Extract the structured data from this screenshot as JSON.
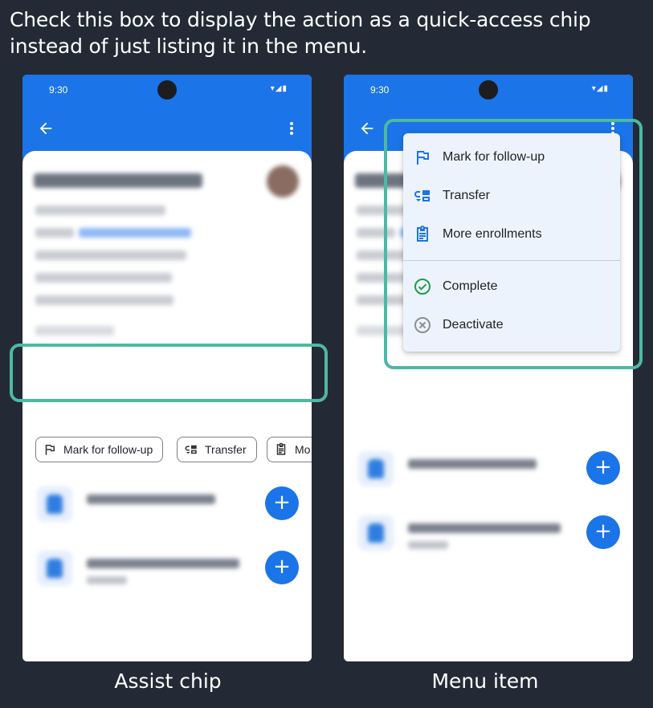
{
  "intro_text": "Check this box to display the action as a quick-access chip instead of just listing it in the menu.",
  "colors": {
    "background": "#232a36",
    "appbar": "#1b74e8",
    "highlight": "#4db8a4",
    "menu_bg": "#edf3fc"
  },
  "left_phone": {
    "status_time": "9:30",
    "chips": [
      {
        "icon": "flag-icon",
        "label": "Mark for follow-up"
      },
      {
        "icon": "transfer-icon",
        "label": "Transfer"
      },
      {
        "icon": "clipboard-icon",
        "label": "Mo"
      }
    ],
    "caption": "Assist chip"
  },
  "right_phone": {
    "status_time": "9:30",
    "menu": {
      "items": [
        {
          "icon": "flag-icon",
          "label": "Mark for follow-up"
        },
        {
          "icon": "transfer-icon",
          "label": "Transfer"
        },
        {
          "icon": "clipboard-icon",
          "label": "More enrollments"
        },
        {
          "icon": "check-circle-icon",
          "label": "Complete"
        },
        {
          "icon": "cancel-circle-icon",
          "label": "Deactivate"
        }
      ]
    },
    "caption": "Menu item"
  }
}
